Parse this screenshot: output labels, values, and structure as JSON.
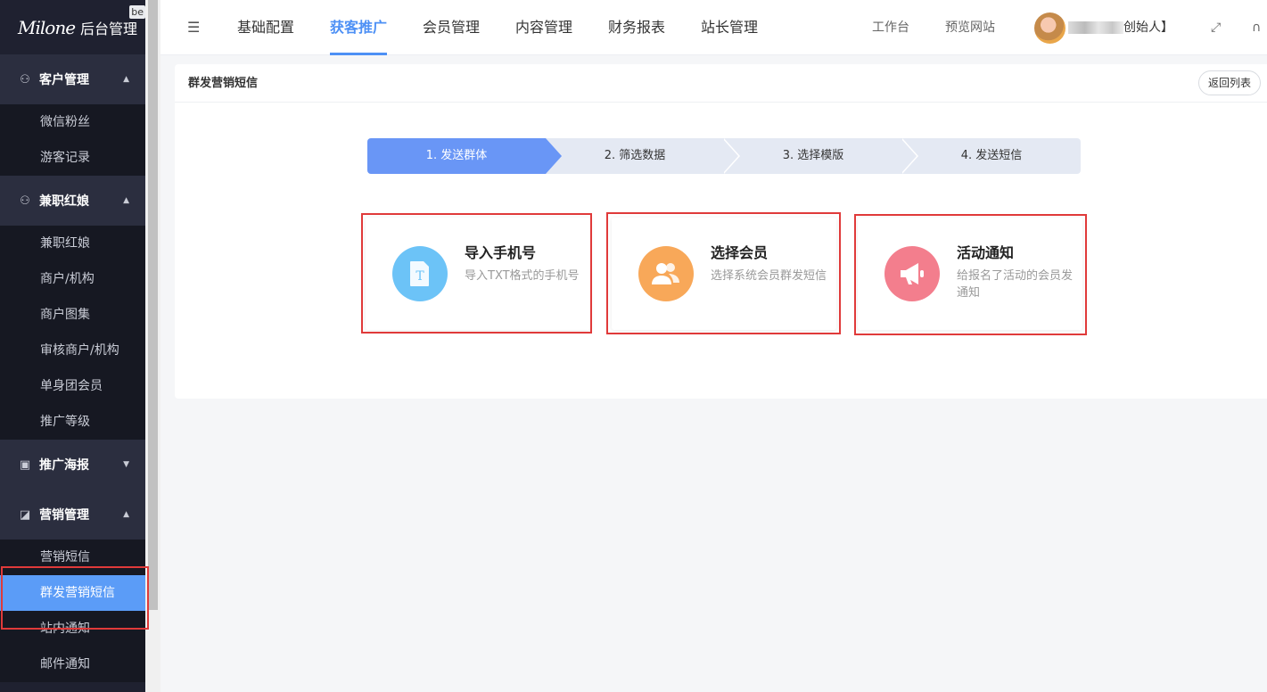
{
  "sidebar": {
    "logo_script": "Milone",
    "logo_title": "后台管理",
    "logo_badge": "be",
    "groups": [
      {
        "label": "客户管理",
        "icon": "users-icon",
        "arrow": "▲",
        "items": [
          "微信粉丝",
          "游客记录"
        ]
      },
      {
        "label": "兼职红娘",
        "icon": "users-icon",
        "arrow": "▲",
        "items": [
          "兼职红娘",
          "商户/机构",
          "商户图集",
          "审核商户/机构",
          "单身团会员",
          "推广等级"
        ]
      },
      {
        "label": "推广海报",
        "icon": "clipboard-icon",
        "arrow": "▼",
        "items": []
      },
      {
        "label": "营销管理",
        "icon": "chart-icon",
        "arrow": "▲",
        "items": [
          "营销短信",
          "群发营销短信",
          "站内通知",
          "邮件通知"
        ]
      }
    ],
    "active_item": "群发营销短信"
  },
  "topnav": {
    "tabs": [
      "基础配置",
      "获客推广",
      "会员管理",
      "内容管理",
      "财务报表",
      "站长管理"
    ],
    "active_tab": "获客推广",
    "links": [
      "工作台",
      "预览网站"
    ],
    "user_name_suffix": "创始人】",
    "icons": [
      "menu-toggle-icon",
      "fullscreen-icon",
      "headset-icon"
    ]
  },
  "page": {
    "title": "群发营销短信",
    "back_label": "返回列表",
    "steps": [
      "1. 发送群体",
      "2. 筛选数据",
      "3. 选择模版",
      "4. 发送短信"
    ],
    "active_step": 0,
    "options": [
      {
        "title": "导入手机号",
        "desc": "导入TXT格式的手机号",
        "icon": "text-file-icon",
        "color": "#6cc3f7"
      },
      {
        "title": "选择会员",
        "desc": "选择系统会员群发短信",
        "icon": "members-icon",
        "color": "#f8a859"
      },
      {
        "title": "活动通知",
        "desc": "给报名了活动的会员发通知",
        "icon": "megaphone-icon",
        "color": "#f37e8d"
      }
    ]
  },
  "colors": {
    "accent": "#4d90f5",
    "sidebar_bg": "#1f2130",
    "active_item": "#5b9cf7",
    "highlight": "#e03a3a"
  }
}
